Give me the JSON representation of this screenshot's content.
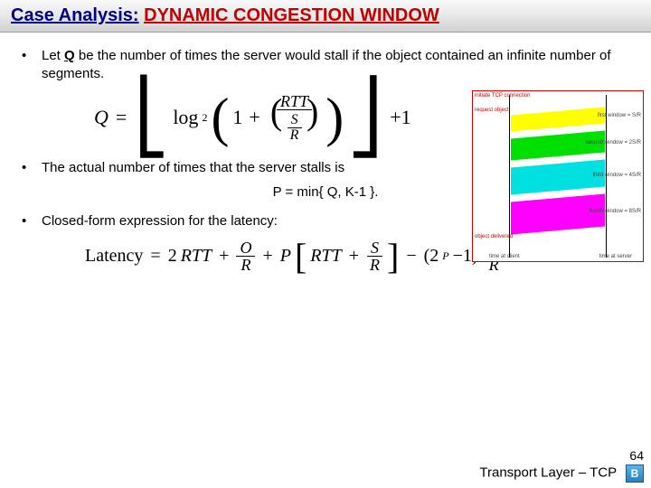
{
  "title": {
    "prefix": "Case Analysis:",
    "emphasis": "DYNAMIC CONGESTION WINDOW"
  },
  "bullets": {
    "b1_pre": "Let ",
    "b1_var": "Q",
    "b1_post": " be the number of times the server would stall if the object contained an infinite number of segments.",
    "b2": "The actual number of times that the server stalls is",
    "b2_formula": "P = min{ Q, K-1 }.",
    "b3": "Closed-form expression for the latency:"
  },
  "formula_q": {
    "lhs": "Q",
    "eq": "=",
    "log": "log",
    "logbase": "2",
    "one": "1",
    "plus": "+",
    "rtt": "RTT",
    "s": "S",
    "r": "R",
    "plus1": "+1"
  },
  "formula_lat": {
    "label": "Latency",
    "eq": "=",
    "two": "2",
    "rtt": "RTT",
    "plus": "+",
    "o": "O",
    "r": "R",
    "p": "P",
    "s": "S",
    "minus": "−",
    "lp": "(2",
    "pexp": "P",
    "m1": "−1)"
  },
  "diagram": {
    "left_label": "initiate TCP connection",
    "req_label": "request object",
    "win1": "first window = S/R",
    "win2": "second window = 2S/R",
    "win3": "third window = 4S/R",
    "win4": "fourth window = 8S/R",
    "done": "object delivered",
    "client": "time at client",
    "server": "time at server"
  },
  "footer": {
    "page": "64",
    "text": "Transport Layer – TCP",
    "icon": "B"
  }
}
